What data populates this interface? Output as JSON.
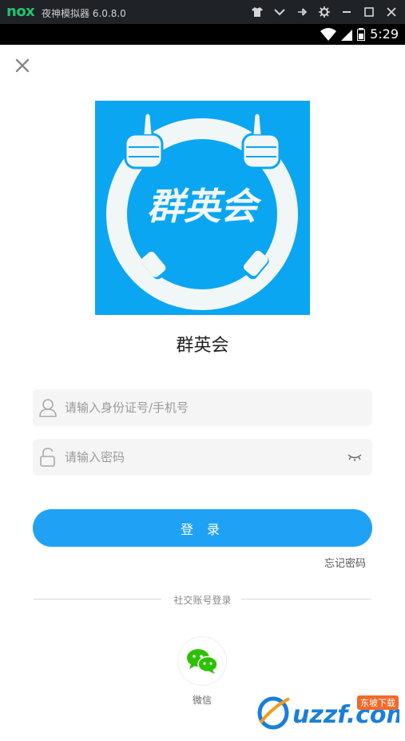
{
  "emulator": {
    "logo": "nox",
    "title": "夜神模拟器 6.0.8.0",
    "buttons": [
      "shirt-icon",
      "chevron-down-icon",
      "pin-icon",
      "gear-icon",
      "minimize-icon",
      "maximize-icon",
      "close-icon"
    ]
  },
  "status_bar": {
    "time": "5:29"
  },
  "login": {
    "app_name": "群英会",
    "logo_text": "群英会",
    "id_placeholder": "请输入身份证号/手机号",
    "password_placeholder": "请输入密码",
    "login_label": "登 录",
    "forgot_label": "忘记密码",
    "social_divider": "社交账号登录",
    "wechat_label": "微信"
  },
  "watermark": {
    "text": "uzzf.com",
    "badge": "东坡下载"
  },
  "colors": {
    "accent": "#1fa2f5",
    "logo_bg": "#0aa6f2",
    "wechat": "#2dc100"
  }
}
